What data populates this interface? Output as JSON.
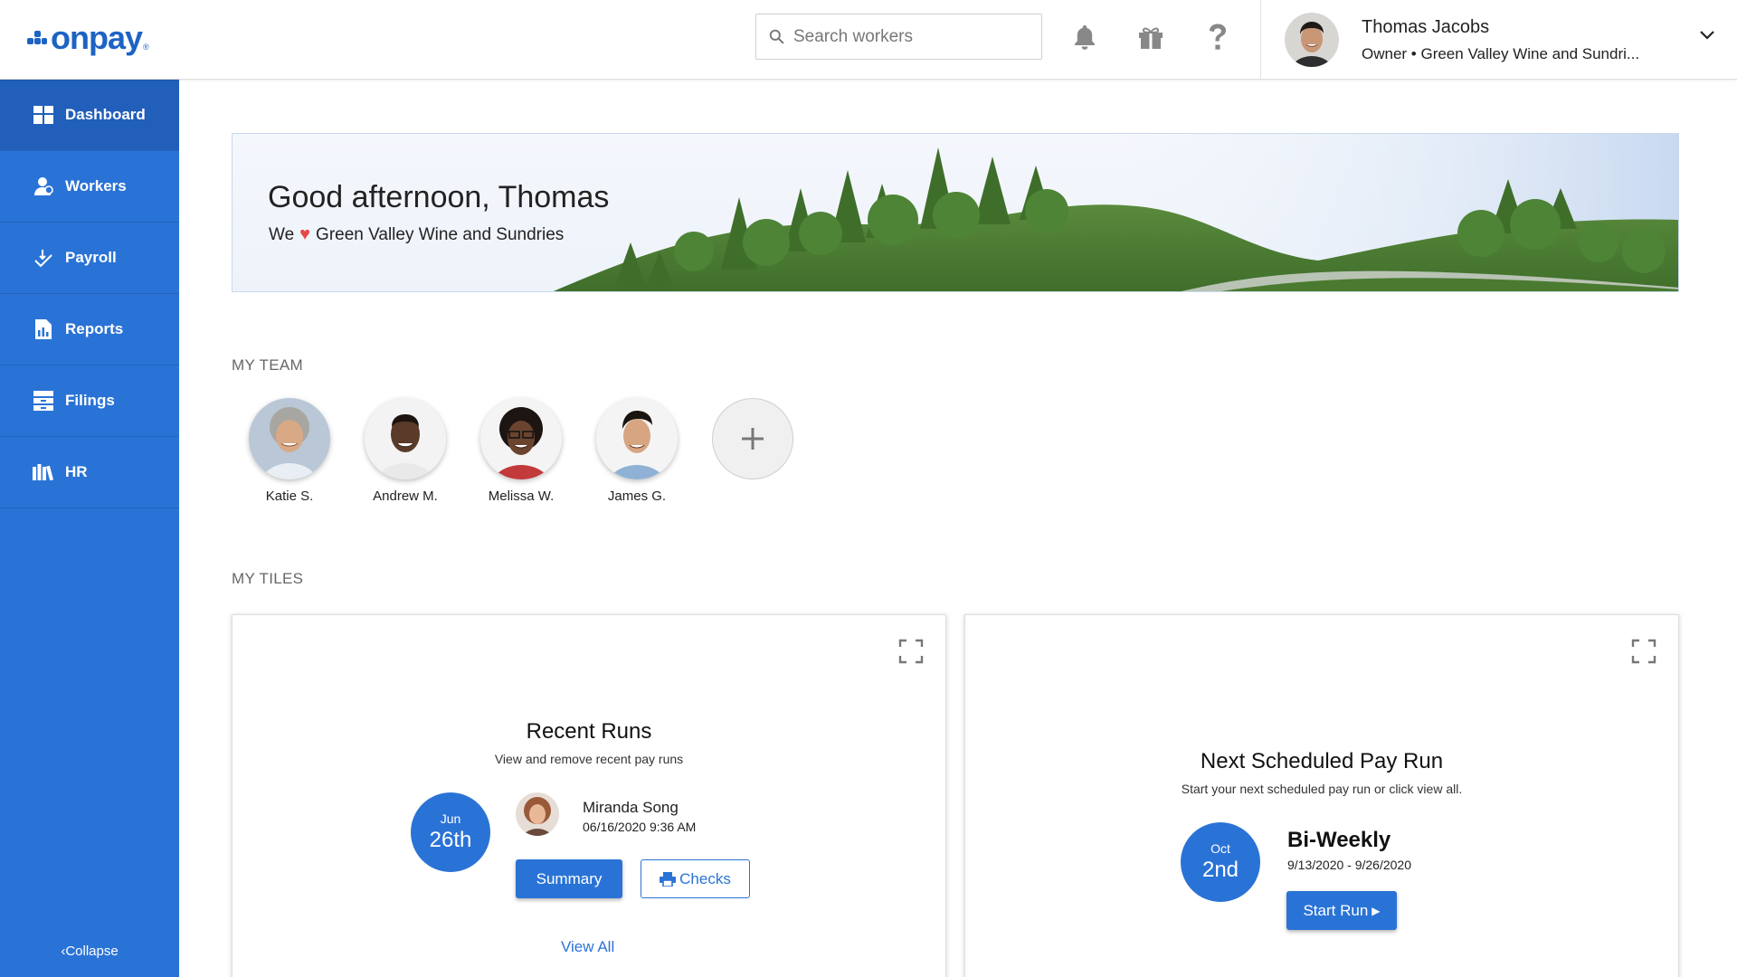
{
  "brand": {
    "name": "onpay",
    "color": "#1d63c4"
  },
  "search": {
    "placeholder": "Search workers"
  },
  "header_icons": [
    "bell-icon",
    "gift-icon",
    "help-icon"
  ],
  "user": {
    "name": "Thomas Jacobs",
    "subtitle": "Owner • Green Valley Wine and Sundri..."
  },
  "sidebar": {
    "items": [
      {
        "label": "Dashboard",
        "icon": "dashboard-icon",
        "active": true
      },
      {
        "label": "Workers",
        "icon": "workers-icon"
      },
      {
        "label": "Payroll",
        "icon": "payroll-icon"
      },
      {
        "label": "Reports",
        "icon": "reports-icon"
      },
      {
        "label": "Filings",
        "icon": "filings-icon"
      },
      {
        "label": "HR",
        "icon": "hr-icon"
      }
    ],
    "collapse_label": "Collapse"
  },
  "banner": {
    "greeting": "Good afternoon, Thomas",
    "we": "We",
    "company": "Green Valley Wine and Sundries"
  },
  "team": {
    "label": "MY TEAM",
    "members": [
      {
        "name": "Katie S."
      },
      {
        "name": "Andrew M."
      },
      {
        "name": "Melissa W."
      },
      {
        "name": "James G."
      }
    ]
  },
  "tiles": {
    "label": "MY TILES",
    "recent_runs": {
      "title": "Recent Runs",
      "subtitle": "View and remove recent pay runs",
      "month": "Jun",
      "day": "26th",
      "person": "Miranda Song",
      "timestamp": "06/16/2020 9:36 AM",
      "summary_label": "Summary",
      "checks_label": "Checks",
      "view_all_label": "View All"
    },
    "next_run": {
      "title": "Next Scheduled Pay Run",
      "subtitle": "Start your next scheduled pay run or click view all.",
      "month": "Oct",
      "day": "2nd",
      "frequency": "Bi-Weekly",
      "period": "9/13/2020 - 9/26/2020",
      "start_label": "Start Run"
    }
  },
  "colors": {
    "accent": "#2a73d6",
    "sidebar": "#2a73d6",
    "heart": "#e54848"
  }
}
